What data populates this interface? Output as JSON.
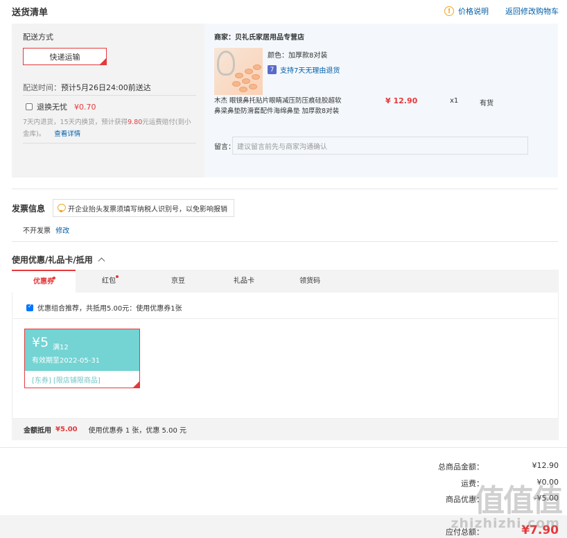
{
  "header": {
    "title": "送货清单",
    "price_note": "价格说明",
    "back_to_cart": "返回修改购物车"
  },
  "delivery": {
    "method_label": "配送方式",
    "method_value": "快递运输",
    "time_label": "配送时间：",
    "time_value": "预计5月26日24:00前送达",
    "return_option": "退换无忧",
    "return_price": "¥0.70",
    "return_desc_1": "7天内退货，15天内换货，预计获得",
    "return_desc_amount": "9.80",
    "return_desc_2": "元运费赔付(到小",
    "return_desc_3": "金库)。",
    "details_link": "查看详情"
  },
  "shop": {
    "name": "商家：贝礼氏家居用品专营店",
    "color_label": "颜色：加厚款8对装",
    "return_policy": "支持7天无理由退货",
    "product_line1": "木杰 眼镜鼻托贴片眼睛减压防压痕硅胶超软",
    "product_line2": "鼻梁鼻垫防滑套配件海绵鼻垫 加厚款8对装",
    "price": "¥ 12.90",
    "qty": "x1",
    "stock": "有货",
    "message_label": "留言：",
    "message_placeholder": "建议留言前先与商家沟通确认"
  },
  "invoice": {
    "title": "发票信息",
    "tip": "开企业抬头发票须填写纳税人识别号，以免影响报销",
    "value": "不开发票",
    "edit": "修改"
  },
  "coupons": {
    "title": "使用优惠/礼品卡/抵用",
    "tabs": [
      "优惠券",
      "红包",
      "京豆",
      "礼品卡",
      "领货码"
    ],
    "recommend": "优惠组合推荐，共抵用5.00元：使用优惠券1张",
    "coupon_amount": "¥5",
    "coupon_condition": "满12",
    "coupon_validity": "有效期至2022-05-31",
    "coupon_tags": "[东券]  [限店铺限商品]",
    "deduct_label": "金额抵用",
    "deduct_amount": "¥5.00",
    "deduct_detail": "使用优惠券 1 张，优惠 5.00 元"
  },
  "totals": {
    "goods_label": "总商品金额：",
    "goods_value": "¥12.90",
    "shipping_label": "运费：",
    "shipping_value": "¥0.00",
    "discount_label": "商品优惠：",
    "discount_value": "-¥5.00",
    "payable_label": "应付总额：",
    "payable_value": "¥7.90"
  },
  "watermark": {
    "logo": "值值值",
    "site": "zhizhizhi.com"
  },
  "colors": {
    "accent": "#e4393c",
    "link": "#005ea7",
    "coupon": "#74d3d3"
  }
}
